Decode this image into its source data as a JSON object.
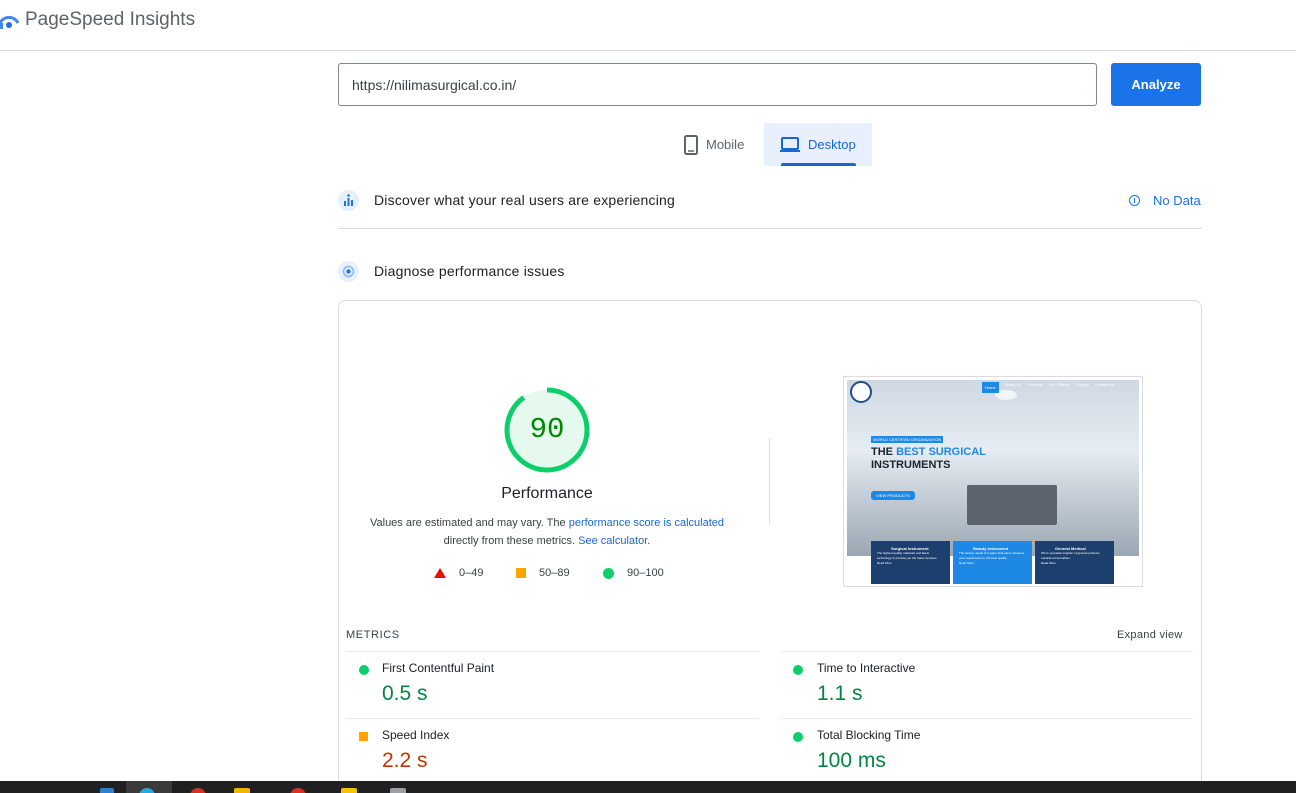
{
  "header": {
    "brand": "PageSpeed Insights",
    "logo_icon": "pagespeed-logo-icon"
  },
  "url_bar": {
    "value": "https://nilimasurgical.co.in/",
    "analyze_label": "Analyze"
  },
  "device_tabs": [
    {
      "label": "Mobile",
      "icon": "mobile-phone-icon",
      "selected": false
    },
    {
      "label": "Desktop",
      "icon": "laptop-icon",
      "selected": true
    }
  ],
  "field_data": {
    "title": "Discover what your real users are experiencing",
    "status": "No Data",
    "status_icon": "info-icon"
  },
  "lab_data": {
    "title": "Diagnose performance issues"
  },
  "performance": {
    "score": "90",
    "score_fraction": 0.9,
    "label": "Performance",
    "desc_1": "Values are estimated and may vary. The ",
    "desc_link_1": "performance score is calculated",
    "desc_2": "directly from these metrics. ",
    "desc_link_2": "See calculator",
    "desc_end": ".",
    "legend": [
      {
        "shape": "triangle",
        "range": "0–49",
        "color": "#eb0f00"
      },
      {
        "shape": "square",
        "range": "50–89",
        "color": "#ffa400"
      },
      {
        "shape": "circle",
        "range": "90–100",
        "color": "#0cce6b"
      }
    ]
  },
  "thumbnail": {
    "nav": [
      "Home",
      "About Us",
      "Products",
      "Our Offices",
      "Enquiry",
      "Contact Us"
    ],
    "tag": "WORLD CERTIFIED ORGANIZATION",
    "heading_1": "THE ",
    "heading_blue": "BEST SURGICAL",
    "heading_2": "INSTRUMENTS",
    "button": "VIEW PRODUCTS",
    "boxes": [
      {
        "title": "Surgical Instrument",
        "text": "The highest quality materials and latest technology to provide you the better services.",
        "more": "Read More"
      },
      {
        "title": "Beauty Instrument",
        "text": "The beauty needs of a salon best serve whatever your requirement is, the best quality.",
        "more": "Read More"
      },
      {
        "title": "General Medical",
        "text": "We're specialist supplier of general products medical consumables.",
        "more": "Read More"
      }
    ]
  },
  "metrics": {
    "title": "METRICS",
    "expand_label": "Expand view",
    "items": [
      {
        "label": "First Contentful Paint",
        "value": "0.5 s",
        "rating": "good",
        "color": "#018642"
      },
      {
        "label": "Time to Interactive",
        "value": "1.1 s",
        "rating": "good",
        "color": "#018642"
      },
      {
        "label": "Speed Index",
        "value": "2.2 s",
        "rating": "average",
        "color": "#c33300"
      },
      {
        "label": "Total Blocking Time",
        "value": "100 ms",
        "rating": "good",
        "color": "#018642"
      }
    ]
  },
  "colors": {
    "accent": "#1a73e8",
    "good": "#0cce6b",
    "average": "#ffa400",
    "poor": "#eb0f00"
  }
}
